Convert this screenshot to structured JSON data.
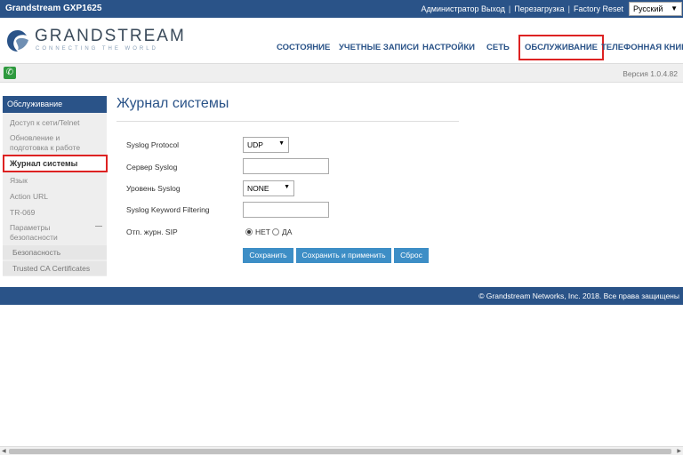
{
  "topbar": {
    "title": "Grandstream GXP1625",
    "admin": "Администратор Выход",
    "reboot": "Перезагрузка",
    "factory_reset": "Factory Reset",
    "language": "Русский"
  },
  "logo": {
    "word": "GRANDSTREAM",
    "tagline": "CONNECTING THE WORLD"
  },
  "nav": {
    "status": "СОСТОЯНИЕ",
    "accounts": "УЧЕТНЫЕ ЗАПИСИ",
    "settings": "НАСТРОЙКИ",
    "network": "СЕТЬ",
    "maintenance": "ОБСЛУЖИВАНИЕ",
    "phonebook": "ТЕЛЕФОННАЯ КНИГА"
  },
  "version": "Версия 1.0.4.82",
  "sidebar": {
    "header": "Обслуживание",
    "items": [
      "Доступ к сети/Telnet",
      "Обновление и подготовка к работе",
      "Журнал системы",
      "Язык",
      "Action URL",
      "TR-069",
      "Параметры безопасности",
      "Безопасность",
      "Trusted CA Certificates"
    ]
  },
  "page": {
    "title": "Журнал системы",
    "syslog_protocol_label": "Syslog Protocol",
    "syslog_protocol_value": "UDP",
    "syslog_server_label": "Сервер Syslog",
    "syslog_server_value": "",
    "syslog_level_label": "Уровень Syslog",
    "syslog_level_value": "NONE",
    "keyword_filter_label": "Syslog Keyword Filtering",
    "keyword_filter_value": "",
    "sip_log_label": "Отп. журн. SIP",
    "sip_no": "НЕТ",
    "sip_yes": "ДА",
    "save": "Сохранить",
    "save_apply": "Сохранить и применить",
    "reset": "Сброс"
  },
  "footer": "© Grandstream Networks, Inc. 2018. Все права защищены",
  "colors": {
    "brand": "#2a5388",
    "button": "#3d8ec6",
    "highlight": "#dd2222"
  }
}
